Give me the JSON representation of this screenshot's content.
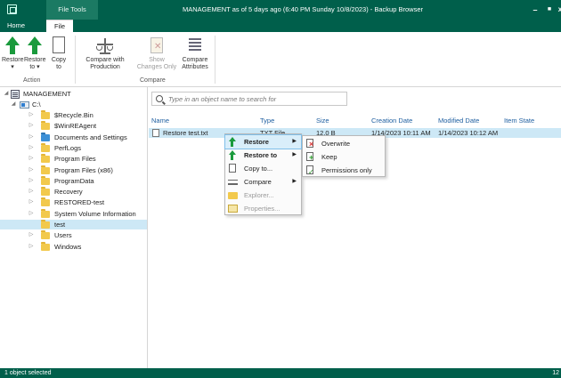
{
  "window": {
    "context_tab_group": "File Tools",
    "title": "MANAGEMENT as of 5 days ago (6:40 PM Sunday 10/8/2023) - Backup Browser"
  },
  "tabs": [
    "Home",
    "File"
  ],
  "ribbon": {
    "action_group": {
      "label": "Action",
      "buttons": [
        {
          "label": "Restore\n▾",
          "icon": "restore-arrow-icon"
        },
        {
          "label": "Restore\nto ▾",
          "icon": "restore-to-arrow-icon"
        },
        {
          "label": "Copy\nto",
          "icon": "copy-document-icon"
        }
      ]
    },
    "compare_group": {
      "label": "Compare",
      "buttons": [
        {
          "label": "Compare with\nProduction",
          "icon": "scale-icon",
          "enabled": true
        },
        {
          "label": "Show\nChanges Only",
          "icon": "show-changes-icon",
          "enabled": false
        },
        {
          "label": "Compare\nAttributes",
          "icon": "attributes-icon",
          "enabled": true
        }
      ]
    }
  },
  "tree": {
    "root": "MANAGEMENT",
    "drive": "C:\\",
    "folders": [
      "$Recycle.Bin",
      "$WinREAgent",
      "Documents and Settings",
      "PerfLogs",
      "Program Files",
      "Program Files (x86)",
      "ProgramData",
      "Recovery",
      "RESTORED-test",
      "System Volume Information",
      "test",
      "Users",
      "Windows"
    ],
    "selected": "test"
  },
  "search": {
    "placeholder": "Type in an object name to search for",
    "value": ""
  },
  "grid": {
    "columns": [
      "Name",
      "Type",
      "Size",
      "Creation Date",
      "Modified Date",
      "Item State"
    ],
    "rows": [
      {
        "name": "Restore test.txt",
        "type": "TXT File",
        "size": "12.0 B",
        "created": "1/14/2023 10:11 AM",
        "modified": "1/14/2023 10:12 AM",
        "state": ""
      }
    ]
  },
  "context_menu": {
    "items": [
      {
        "label": "Restore",
        "icon": "restore-arrow-icon",
        "bold": true,
        "submenu": true,
        "highlight": true,
        "enabled": true
      },
      {
        "label": "Restore to",
        "icon": "restore-to-arrow-icon",
        "bold": true,
        "submenu": true,
        "enabled": true
      },
      {
        "label": "Copy to...",
        "icon": "copy-document-icon",
        "bold": false,
        "submenu": false,
        "enabled": true
      },
      {
        "label": "Compare",
        "icon": "scale-icon",
        "bold": false,
        "submenu": true,
        "enabled": true
      },
      {
        "label": "Explorer...",
        "icon": "folder-icon",
        "bold": false,
        "submenu": false,
        "enabled": false
      },
      {
        "label": "Properties...",
        "icon": "properties-icon",
        "bold": false,
        "submenu": false,
        "enabled": false
      }
    ]
  },
  "restore_submenu": {
    "items": [
      {
        "label": "Overwrite",
        "icon": "overwrite-icon"
      },
      {
        "label": "Keep",
        "icon": "keep-icon"
      },
      {
        "label": "Permissions only",
        "icon": "permissions-icon"
      }
    ]
  },
  "status": {
    "left": "1 object selected",
    "right": "12"
  },
  "colors": {
    "accent": "#005f4b",
    "selection": "#cde8f6",
    "header_text": "#1f5fa0"
  }
}
